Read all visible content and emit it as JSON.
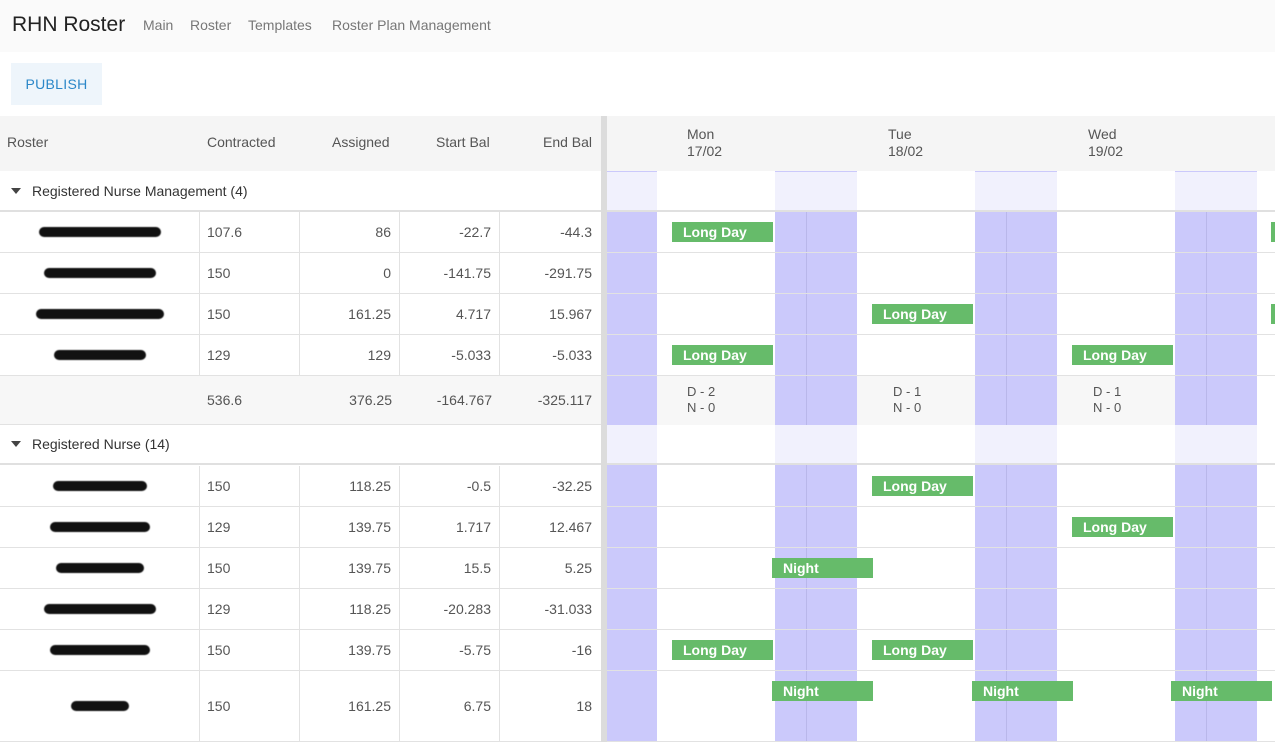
{
  "app": {
    "title": "RHN Roster"
  },
  "nav": [
    "Main",
    "Roster",
    "Templates",
    "Roster Plan Management"
  ],
  "toolbar": {
    "publish_label": "PUBLISH"
  },
  "columns": [
    "Roster",
    "Contracted",
    "Assigned",
    "Start Bal",
    "End Bal"
  ],
  "days": [
    {
      "dow": "Mon",
      "date": "17/02"
    },
    {
      "dow": "Tue",
      "date": "18/02"
    },
    {
      "dow": "Wed",
      "date": "19/02"
    }
  ],
  "groups": [
    {
      "label": "Registered Nurse Management (4)",
      "rows": [
        {
          "contracted": "107.6",
          "assigned": "86",
          "start_bal": "-22.7",
          "end_bal": "-44.3",
          "shifts": [
            {
              "day": 0,
              "type": "Long Day"
            }
          ]
        },
        {
          "contracted": "150",
          "assigned": "0",
          "start_bal": "-141.75",
          "end_bal": "-291.75",
          "shifts": []
        },
        {
          "contracted": "150",
          "assigned": "161.25",
          "start_bal": "4.717",
          "end_bal": "15.967",
          "shifts": [
            {
              "day": 1,
              "type": "Long Day"
            }
          ]
        },
        {
          "contracted": "129",
          "assigned": "129",
          "start_bal": "-5.033",
          "end_bal": "-5.033",
          "shifts": [
            {
              "day": 0,
              "type": "Long Day"
            },
            {
              "day": 2,
              "type": "Long Day"
            }
          ]
        }
      ],
      "summary": {
        "contracted": "536.6",
        "assigned": "376.25",
        "start_bal": "-164.767",
        "end_bal": "-325.117",
        "days": [
          {
            "d": "D - 2",
            "n": "N - 0"
          },
          {
            "d": "D - 1",
            "n": "N - 0"
          },
          {
            "d": "D - 1",
            "n": "N - 0"
          }
        ]
      }
    },
    {
      "label": "Registered Nurse (14)",
      "rows": [
        {
          "contracted": "150",
          "assigned": "118.25",
          "start_bal": "-0.5",
          "end_bal": "-32.25",
          "shifts": [
            {
              "day": 1,
              "type": "Long Day"
            }
          ]
        },
        {
          "contracted": "129",
          "assigned": "139.75",
          "start_bal": "1.717",
          "end_bal": "12.467",
          "shifts": [
            {
              "day": 2,
              "type": "Long Day"
            }
          ]
        },
        {
          "contracted": "150",
          "assigned": "139.75",
          "start_bal": "15.5",
          "end_bal": "5.25",
          "shifts": [
            {
              "day": 0,
              "type": "Night"
            }
          ]
        },
        {
          "contracted": "129",
          "assigned": "118.25",
          "start_bal": "-20.283",
          "end_bal": "-31.033",
          "shifts": []
        },
        {
          "contracted": "150",
          "assigned": "139.75",
          "start_bal": "-5.75",
          "end_bal": "-16",
          "shifts": [
            {
              "day": 0,
              "type": "Long Day"
            },
            {
              "day": 1,
              "type": "Long Day"
            }
          ]
        },
        {
          "contracted": "150",
          "assigned": "161.25",
          "start_bal": "6.75",
          "end_bal": "18",
          "shifts": [
            {
              "day": 0,
              "type": "Night"
            },
            {
              "day": 1,
              "type": "Night"
            },
            {
              "day": 2,
              "type": "Night"
            }
          ]
        }
      ]
    }
  ],
  "colors": {
    "shift": "#66bb6a",
    "weekend_band": "#cbc9fb",
    "link": "#2b87c8"
  }
}
